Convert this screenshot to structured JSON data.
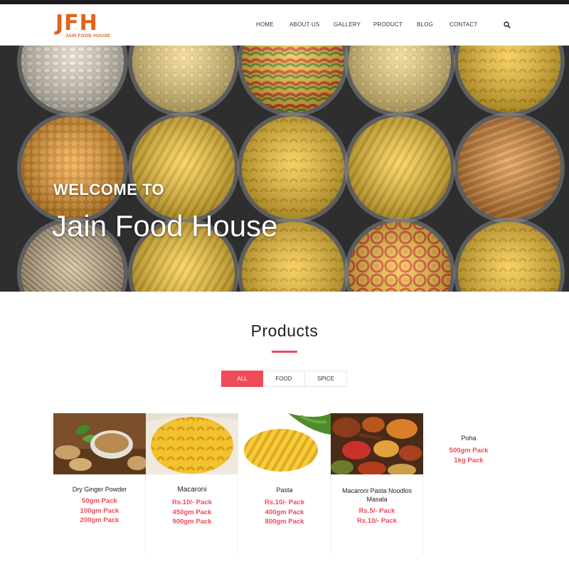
{
  "colors": {
    "accent": "#f04a58",
    "brand": "#e2621b",
    "topbar": "#1d1d1f"
  },
  "header": {
    "logo_mark": "JFH",
    "logo_text": "JAIN FOOD HOUSE",
    "nav": [
      "HOME",
      "ABOUT US",
      "GALLERY",
      "PRODUCT",
      "BLOG",
      "CONTACT"
    ],
    "search_icon": "search-icon"
  },
  "hero": {
    "welcome": "WELCOME TO",
    "brand": "Jain Food House"
  },
  "products": {
    "title": "Products",
    "filters": [
      "ALL",
      "FOOD",
      "SPICE"
    ],
    "active_filter": "ALL",
    "items": [
      {
        "name": "Dry Ginger Powder",
        "prices": [
          "50gm Pack",
          "100gm Pack",
          "200gm Pack"
        ]
      },
      {
        "name": "Macaroni",
        "prices": [
          "Rs.10/- Pack",
          "450gm Pack",
          "900gm Pack"
        ]
      },
      {
        "name": "Pasta",
        "prices": [
          "Rs.10/- Pack",
          "400gm Pack",
          "800gm Pack"
        ]
      },
      {
        "name": "Macaroni Pasta Noodlos Masala",
        "prices": [
          "Rs.5/- Pack",
          "Rs.10/- Pack"
        ]
      },
      {
        "name": "Poha",
        "prices": [
          "500gm Pack",
          "1kg Pack"
        ]
      }
    ]
  }
}
